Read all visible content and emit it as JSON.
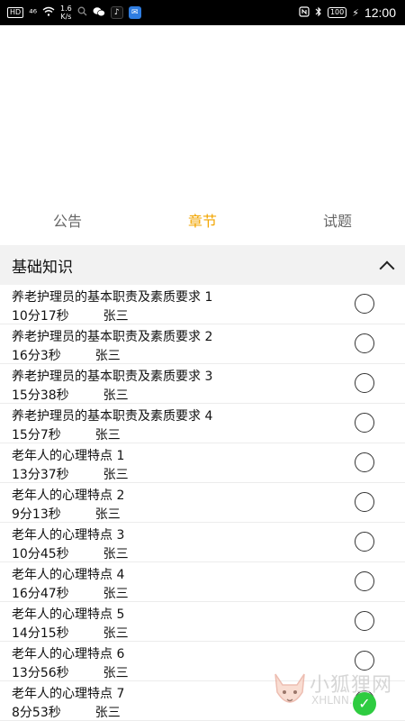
{
  "status_bar": {
    "hd": "HD",
    "signal": "⁴⁶",
    "speed_value": "1.6",
    "speed_unit": "K/s",
    "battery": "100",
    "time": "12:00"
  },
  "tabs": [
    {
      "label": "公告",
      "active": false
    },
    {
      "label": "章节",
      "active": true
    },
    {
      "label": "试题",
      "active": false
    }
  ],
  "section": {
    "title": "基础知识"
  },
  "items": [
    {
      "title": "养老护理员的基本职责及素质要求 1",
      "duration": "10分17秒",
      "author": "张三"
    },
    {
      "title": "养老护理员的基本职责及素质要求 2",
      "duration": "16分3秒",
      "author": "张三"
    },
    {
      "title": "养老护理员的基本职责及素质要求 3",
      "duration": "15分38秒",
      "author": "张三"
    },
    {
      "title": "养老护理员的基本职责及素质要求 4",
      "duration": "15分7秒",
      "author": "张三"
    },
    {
      "title": "老年人的心理特点 1",
      "duration": "13分37秒",
      "author": "张三"
    },
    {
      "title": "老年人的心理特点 2",
      "duration": "9分13秒",
      "author": "张三"
    },
    {
      "title": "老年人的心理特点 3",
      "duration": "10分45秒",
      "author": "张三"
    },
    {
      "title": "老年人的心理特点 4",
      "duration": "16分47秒",
      "author": "张三"
    },
    {
      "title": "老年人的心理特点 5",
      "duration": "14分15秒",
      "author": "张三"
    },
    {
      "title": "老年人的心理特点 6",
      "duration": "13分56秒",
      "author": "张三"
    },
    {
      "title": "老年人的心理特点 7",
      "duration": "8分53秒",
      "author": "张三"
    }
  ],
  "watermark": {
    "cn": "小狐狸网",
    "en": "XHLNN.CN"
  },
  "colors": {
    "accent": "#f2a500",
    "section_bg": "#f2f2f2",
    "status_bg": "#000000"
  }
}
